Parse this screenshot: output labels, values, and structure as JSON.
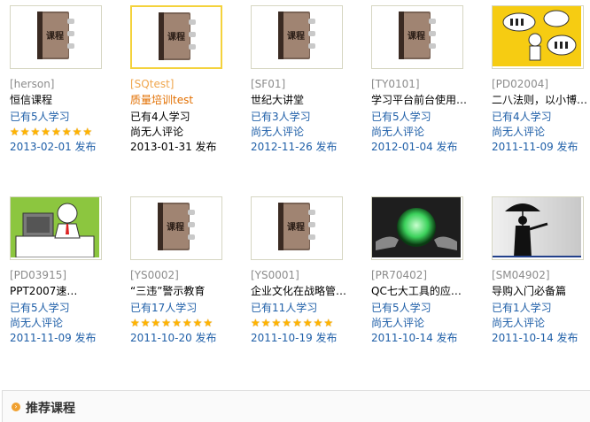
{
  "courses": [
    {
      "code": "[herson]",
      "title": "恒信课程",
      "learners": "已有5人学习",
      "review": null,
      "stars": 8,
      "date": "2013-02-01 发布",
      "thumb": "book-icon",
      "highlight": false
    },
    {
      "code": "[SQtest]",
      "title": "质量培训test",
      "learners": "已有4人学习",
      "review": "尚无人评论",
      "stars": 0,
      "date": "2013-01-31 发布",
      "thumb": "book-icon",
      "highlight": true
    },
    {
      "code": "[SF01]",
      "title": "世纪大讲堂",
      "learners": "已有3人学习",
      "review": "尚无人评论",
      "stars": 0,
      "date": "2012-11-26 发布",
      "thumb": "book-icon",
      "highlight": false
    },
    {
      "code": "[TY0101]",
      "title": "学习平台前台使用…",
      "learners": "已有5人学习",
      "review": "尚无人评论",
      "stars": 0,
      "date": "2012-01-04 发布",
      "thumb": "book-icon",
      "highlight": false
    },
    {
      "code": "[PD02004]",
      "title": "二八法则，以小博…",
      "learners": "已有4人学习",
      "review": "尚无人评论",
      "stars": 0,
      "date": "2011-11-09 发布",
      "thumb": "people-cartoon-icon",
      "highlight": false
    },
    {
      "code": "[PD03915]",
      "title": "PPT2007速…",
      "learners": "已有5人学习",
      "review": "尚无人评论",
      "stars": 0,
      "date": "2011-11-09 发布",
      "thumb": "computer-cartoon-icon",
      "highlight": false
    },
    {
      "code": "[YS0002]",
      "title": "“三违”警示教育",
      "learners": "已有17人学习",
      "review": null,
      "stars": 8,
      "date": "2011-10-20 发布",
      "thumb": "book-icon",
      "highlight": false
    },
    {
      "code": "[YS0001]",
      "title": "企业文化在战略管…",
      "learners": "已有11人学习",
      "review": null,
      "stars": 8,
      "date": "2011-10-19 发布",
      "thumb": "book-icon",
      "highlight": false
    },
    {
      "code": "[PR70402]",
      "title": "QC七大工具的应…",
      "learners": "已有5人学习",
      "review": "尚无人评论",
      "stars": 0,
      "date": "2011-10-14 发布",
      "thumb": "crystal-ball-icon",
      "highlight": false
    },
    {
      "code": "[SM04902]",
      "title": "导购入门必备篇",
      "learners": "已有1人学习",
      "review": "尚无人评论",
      "stars": 0,
      "date": "2011-10-14 发布",
      "thumb": "umbrella-man-icon",
      "highlight": false
    }
  ],
  "book_label": "课程",
  "section": {
    "title": "推荐课程"
  },
  "colors": {
    "link": "#1f5fa8",
    "highlight": "#e26f00",
    "border_active": "#f4d23c"
  }
}
